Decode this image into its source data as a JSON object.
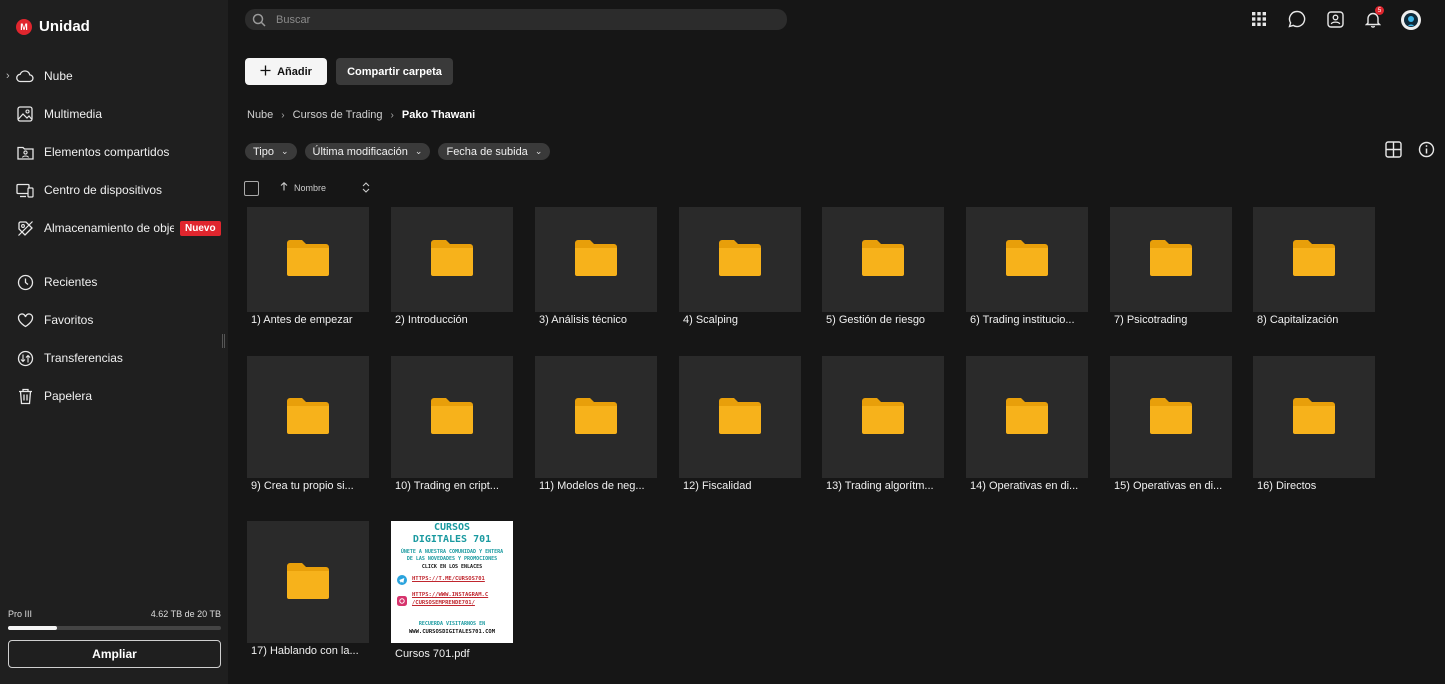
{
  "app": {
    "name": "Unidad",
    "logo_letter": "M"
  },
  "sidebar": {
    "items": [
      {
        "label": "Nube",
        "icon": "cloud-icon"
      },
      {
        "label": "Multimedia",
        "icon": "image-icon"
      },
      {
        "label": "Elementos compartidos",
        "icon": "shared-folder-icon"
      },
      {
        "label": "Centro de dispositivos",
        "icon": "devices-icon"
      },
      {
        "label": "Almacenamiento de objetos",
        "icon": "object-storage-icon",
        "badge": "Nuevo"
      },
      {
        "label": "Recientes",
        "icon": "clock-icon"
      },
      {
        "label": "Favoritos",
        "icon": "heart-icon"
      },
      {
        "label": "Transferencias",
        "icon": "transfers-icon"
      },
      {
        "label": "Papelera",
        "icon": "trash-icon"
      }
    ],
    "plan": {
      "name": "Pro III",
      "usage": "4.62 TB de 20 TB",
      "fraction": 0.231
    },
    "upgrade_label": "Ampliar"
  },
  "topbar": {
    "search_placeholder": "Buscar",
    "icons": [
      "apps-grid-icon",
      "chat-icon",
      "contacts-icon",
      "bell-icon",
      "avatar"
    ],
    "notification_count": "5"
  },
  "actions": {
    "add_label": "Añadir",
    "share_label": "Compartir carpeta"
  },
  "breadcrumb": [
    "Nube",
    "Cursos de Trading",
    "Pako Thawani"
  ],
  "filters": [
    "Tipo",
    "Última modificación",
    "Fecha de subida"
  ],
  "sort": {
    "label": "Nombre"
  },
  "items": [
    "1) Antes de empezar",
    "2) Introducción",
    "3) Análisis técnico",
    "4) Scalping",
    "5) Gestión de riesgo",
    "6) Trading institucio...",
    "7) Psicotrading",
    "8) Capitalización",
    "9) Crea tu propio si...",
    "10) Trading en cript...",
    "11) Modelos de neg...",
    "12) Fiscalidad",
    "13) Trading algorítm...",
    "14) Operativas en di...",
    "15) Operativas en di...",
    "16) Directos",
    "17) Hablando con la..."
  ],
  "pdf": {
    "name": "Cursos 701.pdf",
    "thumb": {
      "line1": "CURSOS",
      "line2": "DIGITALES 701",
      "line3": "ÚNETE A NUESTRA COMUNIDAD Y ENTERA",
      "line4": "DE LAS NOVEDADES Y PROMOCIONES",
      "line5": "CLICK EN LOS ENLACES",
      "link1": "HTTPS://T.ME/CURSOS701",
      "link2a": "HTTPS://WWW.INSTAGRAM.C",
      "link2b": "/CURSOSEMPRENDE701/",
      "line6": "RECUERDA VISITARNOS EN",
      "line7": "WWW.CURSOSDIGITALES701.COM"
    }
  },
  "colors": {
    "accent": "#e0262e",
    "folder": "#f7b21b",
    "folder_dark": "#e89f0a"
  }
}
